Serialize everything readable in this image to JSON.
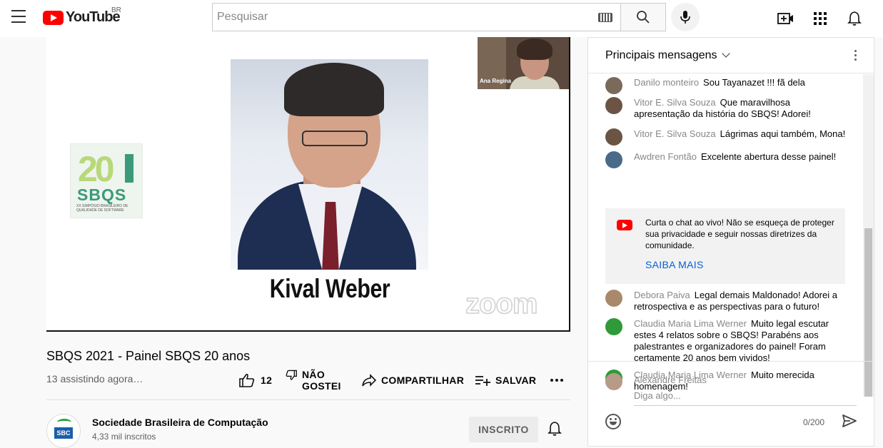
{
  "header": {
    "logo_text": "YouTube",
    "region": "BR",
    "search_placeholder": "Pesquisar"
  },
  "video": {
    "slide_name": "Kival Weber",
    "sbqs_logo": {
      "number": "20",
      "anos": "ANOS",
      "word": "SBQS",
      "subtitle": "XX SIMPÓSIO BRASILEIRO DE QUALIDADE DE SOFTWARE"
    },
    "watermark": "zoom",
    "pip_name": "Ana Regina"
  },
  "meta": {
    "title": "SBQS 2021 - Painel SBQS 20 anos",
    "viewers": "13 assistindo agora…",
    "likes": "12",
    "dislike_label_1": "NÃO",
    "dislike_label_2": "GOSTEI",
    "share_label": "COMPARTILHAR",
    "save_label": "SALVAR"
  },
  "channel": {
    "name": "Sociedade Brasileira de Computação",
    "subscribers": "4,33 mil inscritos",
    "avatar_text": "SBC",
    "subscribe_label": "INSCRITO"
  },
  "chat": {
    "header": "Principais mensagens",
    "messages": [
      {
        "author": "Danilo monteiro",
        "text": "Sou Tayanazet !!! fã dela",
        "color": "#7a6a5a"
      },
      {
        "author": "Vitor E. Silva Souza",
        "text": "Que maravilhosa apresentação da história do SBQS! Adorei!",
        "color": "#6b5444"
      },
      {
        "author": "Vitor E. Silva Souza",
        "text": "Lágrimas aqui também, Mona!",
        "color": "#6b5444"
      },
      {
        "author": "Awdren Fontão",
        "text": "Excelente abertura desse painel!",
        "color": "#4a6a8a"
      },
      {
        "author": "Debora Paiva",
        "text": "Legal demais Maldonado! Adorei a retrospectiva e as perspectivas para o futuro!",
        "color": "#a88a6a"
      },
      {
        "author": "Claudia Maria Lima Werner",
        "text": "Muito legal escutar estes 4 relatos sobre o SBQS! Parabéns aos palestrantes e organizadores do painel! Foram certamente 20 anos bem vividos!",
        "color": "#2e9a3a"
      },
      {
        "author": "Claudia Maria Lima Werner",
        "text": "Muito merecida homenagem!",
        "color": "#2e9a3a"
      }
    ],
    "notice_text": "Curta o chat ao vivo! Não se esqueça de proteger sua privacidade e seguir nossas diretrizes da comunidade.",
    "notice_link": "SAIBA MAIS",
    "me_name": "Alexandre Freitas",
    "input_placeholder": "Diga algo...",
    "counter": "0/200"
  }
}
